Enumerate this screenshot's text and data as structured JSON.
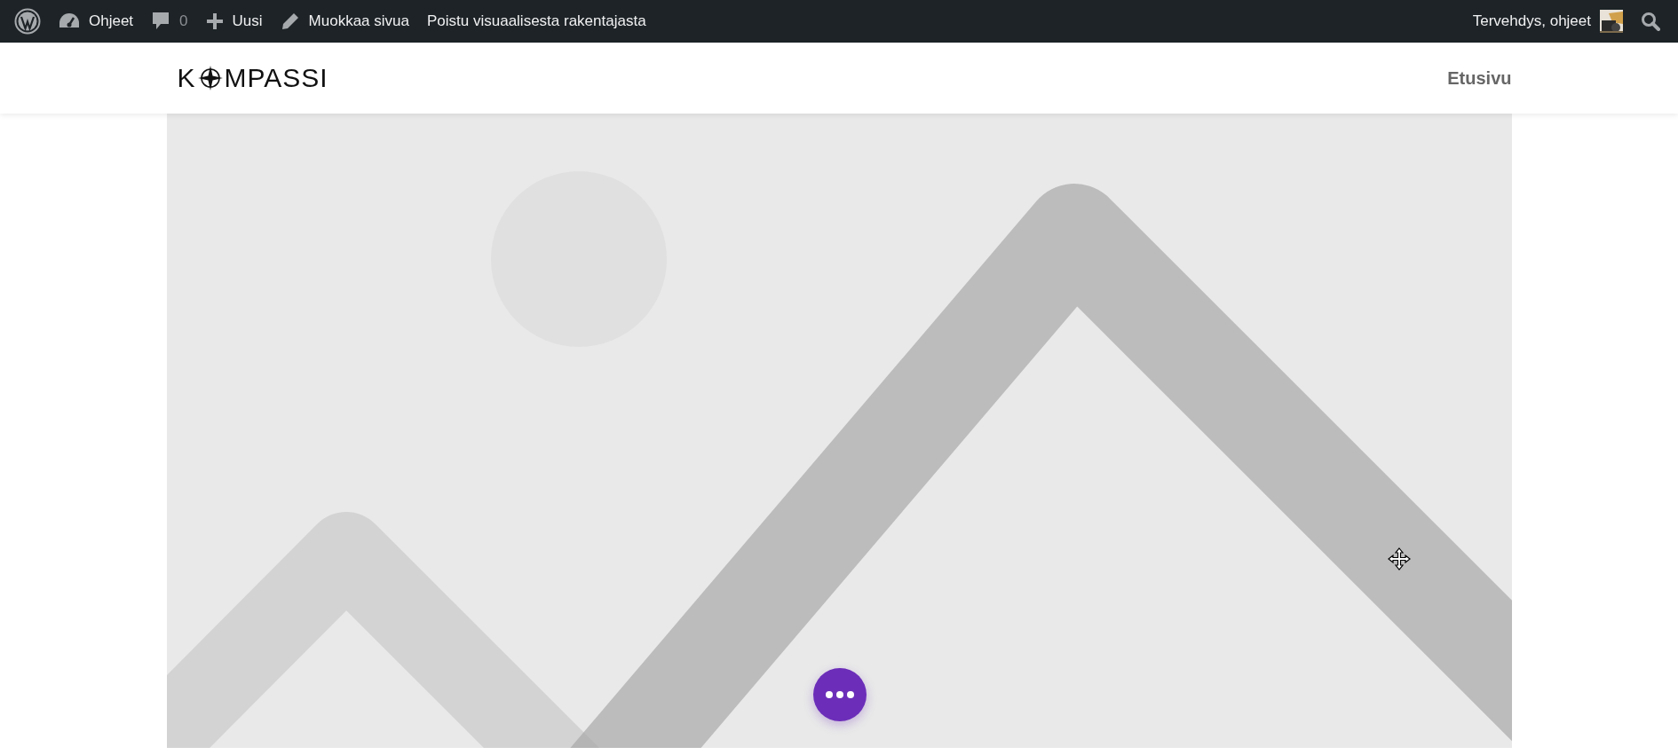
{
  "admin_bar": {
    "items": [
      {
        "kind": "wp-logo"
      },
      {
        "kind": "dashboard",
        "label": "Ohjeet"
      },
      {
        "kind": "comments",
        "label": "0"
      },
      {
        "kind": "new",
        "label": "Uusi"
      },
      {
        "kind": "edit",
        "label": "Muokkaa sivua"
      },
      {
        "kind": "text",
        "label": "Poistu visuaalisesta rakentajasta"
      }
    ],
    "greeting": "Tervehdys, ohjeet"
  },
  "header": {
    "logo": {
      "before": "K",
      "after": "MPASSI"
    },
    "nav": [
      {
        "label": "Etusivu"
      }
    ]
  }
}
